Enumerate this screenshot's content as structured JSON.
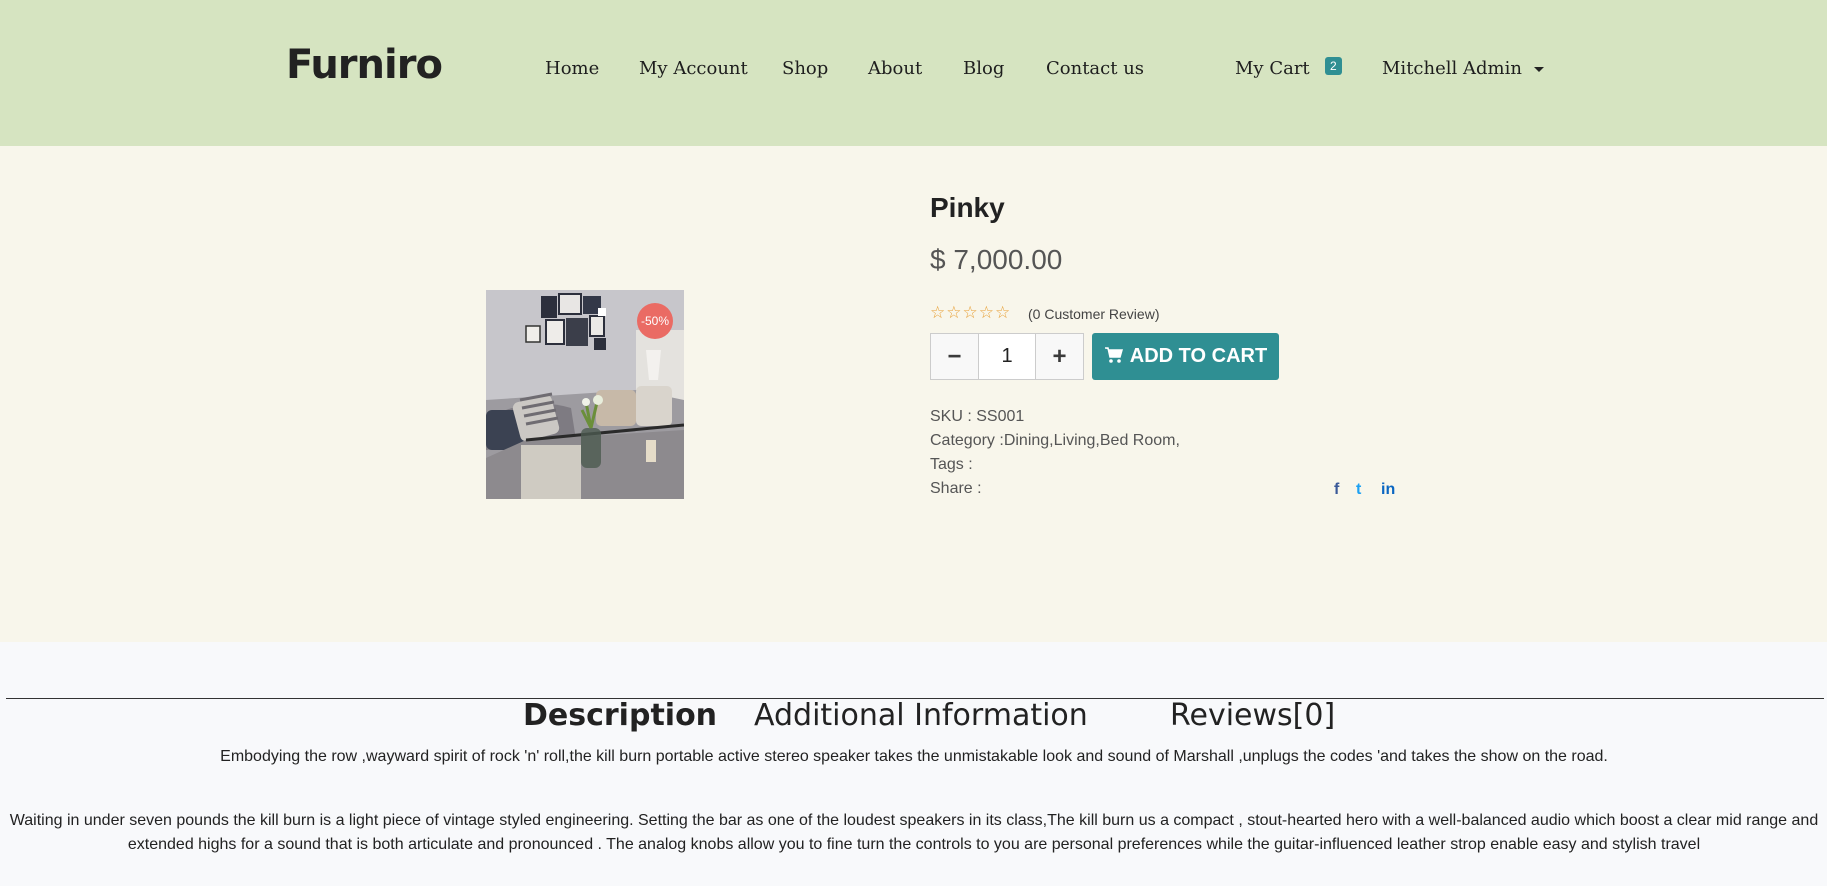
{
  "header": {
    "logo": "Furniro",
    "nav": [
      "Home",
      "My Account",
      "Shop",
      "About",
      "Blog",
      "Contact us"
    ],
    "cart_label": "My Cart",
    "cart_count": "2",
    "user": "Mitchell Admin"
  },
  "product": {
    "discount_badge": "-50%",
    "name": "Pinky",
    "price": "$ 7,000.00",
    "rating": 0,
    "stars": "☆☆☆☆☆",
    "review_text": "(0 Customer Review)",
    "quantity": "1",
    "minus": "−",
    "plus": "+",
    "add_to_cart": "ADD TO CART",
    "sku": "SKU : SS001",
    "category": "Category :Dining,Living,Bed Room,",
    "tags": "Tags :",
    "share": "Share :",
    "social": [
      "f",
      "t",
      "in"
    ]
  },
  "tabs": [
    "Description",
    "Additional Information",
    "Reviews[0]"
  ],
  "description": [
    "Embodying the row ,wayward spirit of rock 'n' roll,the kill burn portable active stereo speaker takes the unmistakable look and sound of Marshall ,unplugs the codes 'and takes the show on the road.",
    "Waiting in under seven pounds the kill burn is  a light piece of vintage styled engineering. Setting the bar as one of the loudest speakers in its class,The kill burn us a compact , stout-hearted  hero with a well-balanced audio which boost a clear mid range and extended highs for a sound that is both articulate and pronounced . The analog knobs allow you to fine turn the controls to you  are personal preferences while the guitar-influenced leather strop enable easy and stylish travel"
  ],
  "colors": {
    "header_bg": "#d6e4c1",
    "product_bg": "#f8f6eb",
    "accent": "#2f8f93",
    "badge": "#ea6b64",
    "stars": "#e8a23a"
  }
}
